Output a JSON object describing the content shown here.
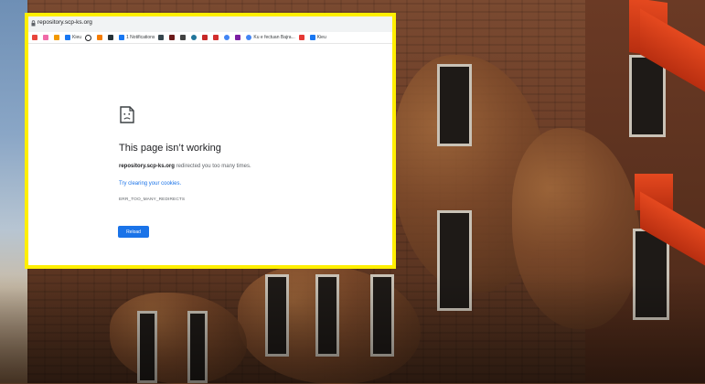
{
  "browser": {
    "url": "repository.scp-ks.org",
    "bookmarks": [
      {
        "icon": "bookmark-favicon-icon",
        "label": "",
        "color": "#e8453c"
      },
      {
        "icon": "bookmark-favicon-icon",
        "label": "",
        "color": "#f06ba8"
      },
      {
        "icon": "bookmark-favicon-icon",
        "label": "",
        "color": "#f29900"
      },
      {
        "icon": "facebook-icon",
        "label": "Kieu",
        "color": "#1877f2"
      },
      {
        "icon": "circle-icon",
        "label": "",
        "color": "#202124"
      },
      {
        "icon": "bookmark-favicon-icon",
        "label": "",
        "color": "#f57c00"
      },
      {
        "icon": "bookmark-favicon-icon",
        "label": "",
        "color": "#263238"
      },
      {
        "icon": "facebook-icon",
        "label": "1 Notifications",
        "color": "#1877f2"
      },
      {
        "icon": "bookmark-favicon-icon",
        "label": "",
        "color": "#37474f"
      },
      {
        "icon": "bookmark-favicon-icon",
        "label": "",
        "color": "#6d1b1b"
      },
      {
        "icon": "bookmark-favicon-icon",
        "label": "",
        "color": "#424242"
      },
      {
        "icon": "wordpress-icon",
        "label": "",
        "color": "#21759b"
      },
      {
        "icon": "bookmark-favicon-icon",
        "label": "",
        "color": "#c62828"
      },
      {
        "icon": "bookmark-favicon-icon",
        "label": "",
        "color": "#d32f2f"
      },
      {
        "icon": "google-icon",
        "label": "",
        "color": "#4285f4"
      },
      {
        "icon": "bookmark-favicon-icon",
        "label": "",
        "color": "#7b1fa2"
      },
      {
        "icon": "google-icon",
        "label": "Ku e fectuan Bajra...",
        "color": "#4285f4"
      },
      {
        "icon": "bookmark-favicon-icon",
        "label": "",
        "color": "#e53935"
      },
      {
        "icon": "facebook-icon",
        "label": "Kieu",
        "color": "#1877f2"
      }
    ]
  },
  "error_page": {
    "title": "This page isn’t working",
    "domain": "repository.scp-ks.org",
    "detail_suffix": " redirected you too many times.",
    "link": "Try clearing your cookies.",
    "code": "ERR_TOO_MANY_REDIRECTS",
    "reload_label": "Reload"
  },
  "colors": {
    "highlight_border": "#ffef00",
    "accent": "#1a73e8"
  }
}
